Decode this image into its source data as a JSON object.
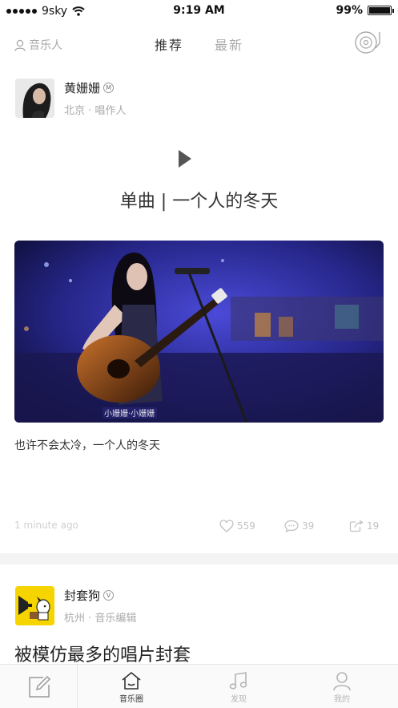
{
  "status_bar": {
    "carrier": "9sky",
    "time": "9:19 AM",
    "battery": "99%",
    "battery_level": 0.99
  },
  "nav": {
    "musician_label": "音乐人",
    "tabs": [
      {
        "label": "推荐",
        "active": true
      },
      {
        "label": "最新",
        "active": false
      }
    ]
  },
  "posts": [
    {
      "author": "黄姗姗",
      "badge": "M",
      "meta": "北京 · 唱作人",
      "title": "单曲 | 一个人的冬天",
      "caption": "也许不会太冷，一个人的冬天",
      "time": "1 minute ago",
      "likes": "559",
      "comments": "39",
      "shares": "19",
      "icons": {
        "like": "heart-icon",
        "comment": "comment-icon",
        "share": "share-icon"
      }
    },
    {
      "author": "封套狗",
      "badge": "V",
      "meta": "杭州 · 音乐编辑",
      "title": "被模仿最多的唱片封套"
    }
  ],
  "tabbar": {
    "items": [
      {
        "label": "音乐圈",
        "icon": "home-icon",
        "active": true
      },
      {
        "label": "发现",
        "icon": "music-note-icon",
        "active": false
      },
      {
        "label": "我的",
        "icon": "person-icon",
        "active": false
      }
    ]
  },
  "colors": {
    "text": "#333333",
    "muted": "#aaaaaa",
    "photo_stage": "#2a2a8c",
    "avatar2_bg": "#f5d400"
  }
}
